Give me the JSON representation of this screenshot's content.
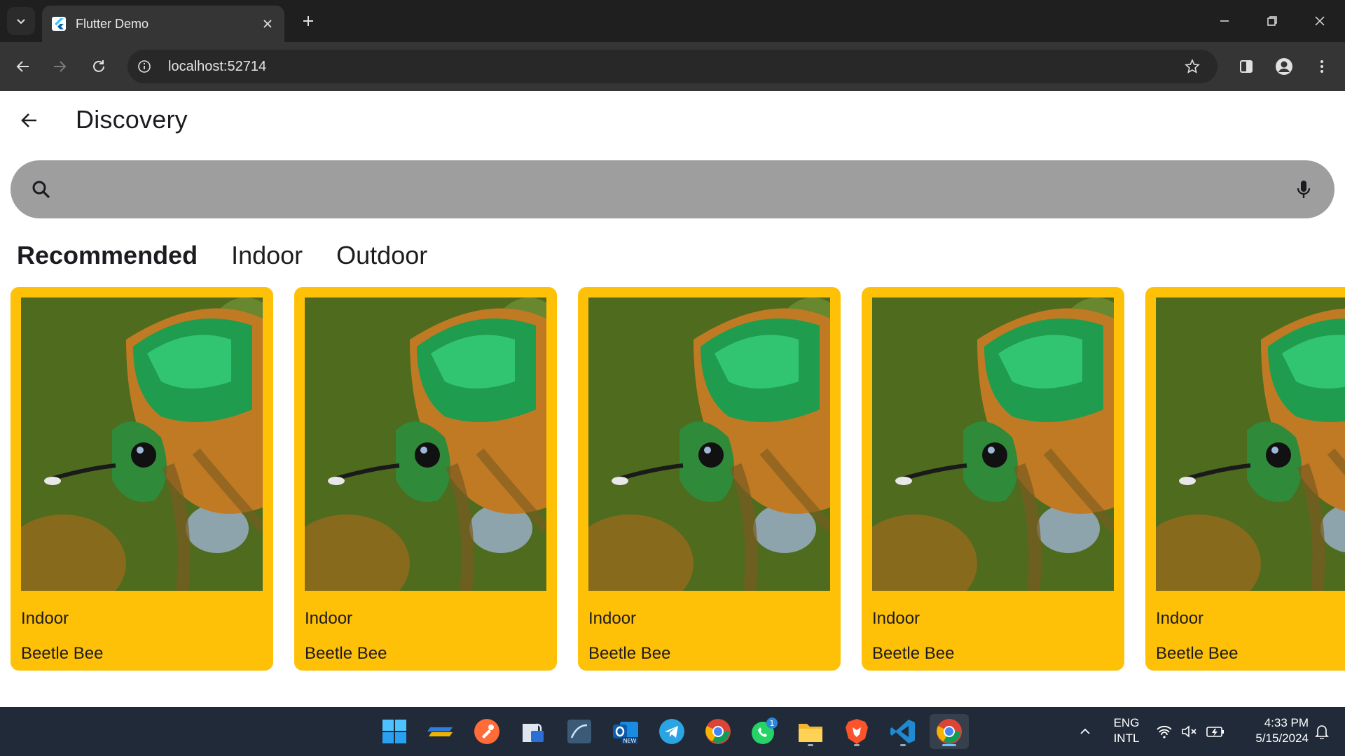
{
  "browser": {
    "tab_title": "Flutter Demo",
    "url": "localhost:52714"
  },
  "app": {
    "title": "Discovery",
    "search": {
      "value": "",
      "placeholder": ""
    },
    "tabs": [
      {
        "label": "Recommended",
        "active": true
      },
      {
        "label": "Indoor",
        "active": false
      },
      {
        "label": "Outdoor",
        "active": false
      }
    ],
    "cards": [
      {
        "category": "Indoor",
        "name": "Beetle Bee"
      },
      {
        "category": "Indoor",
        "name": "Beetle Bee"
      },
      {
        "category": "Indoor",
        "name": "Beetle Bee"
      },
      {
        "category": "Indoor",
        "name": "Beetle Bee"
      },
      {
        "category": "Indoor",
        "name": "Beetle Bee"
      }
    ],
    "card_color": "#ffc107",
    "search_bar_color": "#9e9e9e"
  },
  "taskbar": {
    "apps": [
      "windows-start-icon",
      "toolbox-app-icon",
      "postman-icon",
      "file-lock-app-icon",
      "mysql-workbench-icon",
      "outlook-new-icon",
      "telegram-icon",
      "chrome-icon",
      "whatsapp-icon",
      "file-explorer-icon",
      "brave-icon",
      "vscode-icon",
      "chrome-active-icon"
    ],
    "whatsapp_badge": "1",
    "language_line1": "ENG",
    "language_line2": "INTL",
    "time": "4:33 PM",
    "date": "5/15/2024"
  }
}
